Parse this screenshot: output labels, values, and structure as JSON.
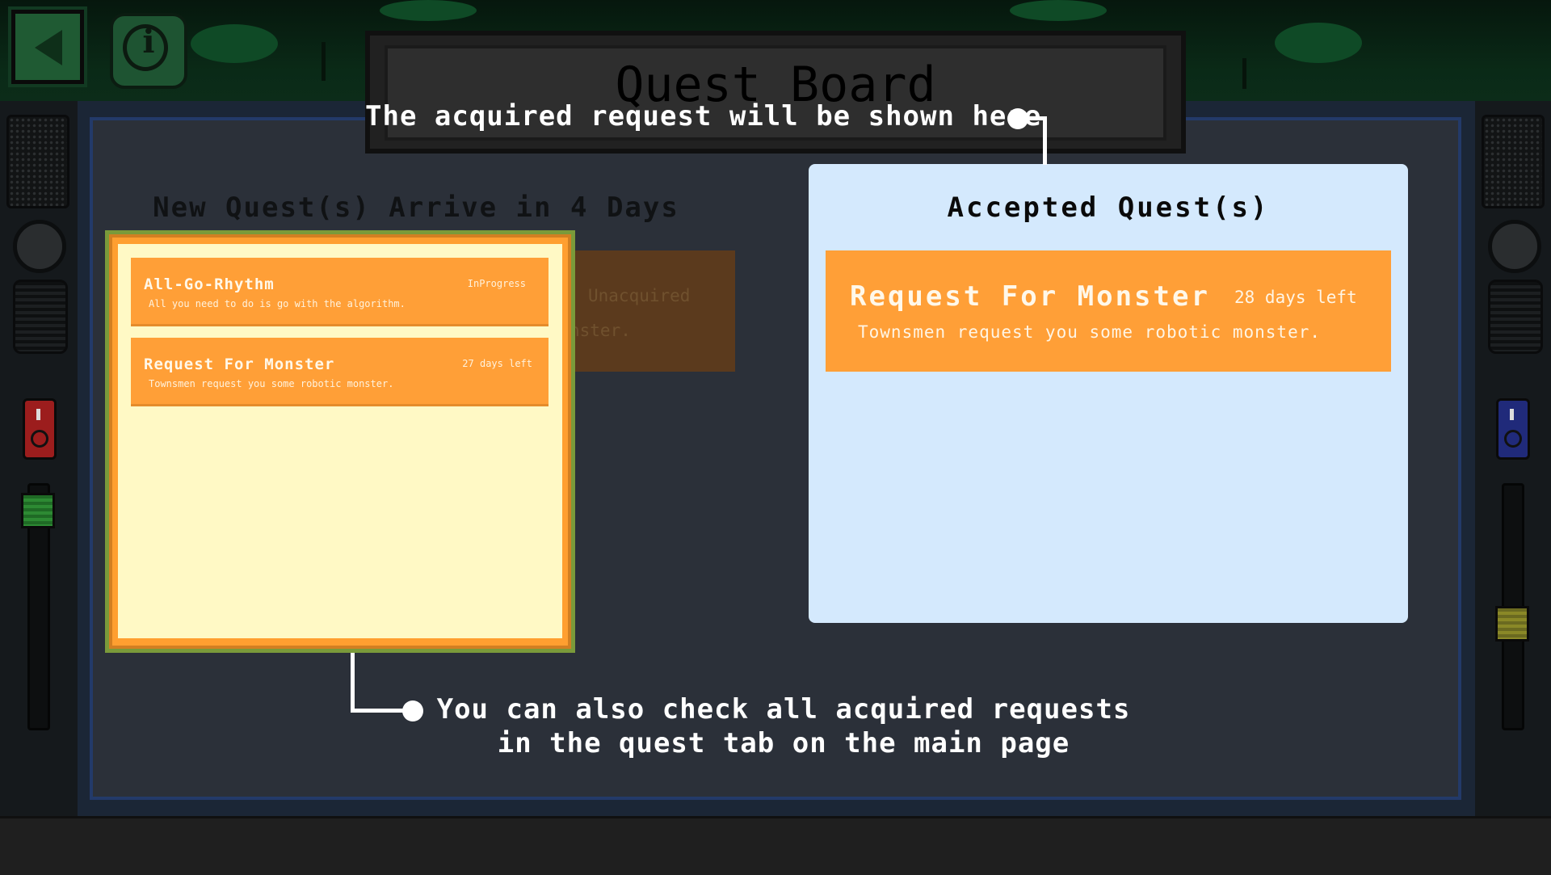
{
  "screen": {
    "title": "Quest Board",
    "arrival_prefix": "New Quest(s) Arrive in",
    "arrival_count": "4",
    "arrival_unit": "Days"
  },
  "hud": {
    "back_icon": "back-arrow-icon",
    "info_icon": "info-icon",
    "info_letter": "i"
  },
  "acquired_panel": {
    "quests": [
      {
        "title": "All-Go-Rhythm",
        "status": "InProgress",
        "description": "All you need to do is go with the algorithm."
      },
      {
        "title": "Request For Monster",
        "status": "27 days left",
        "description": "Townsmen request you some robotic monster."
      }
    ]
  },
  "background_card": {
    "status_fragment": "Unacquired",
    "desc_fragment": "nster."
  },
  "accepted_panel": {
    "header": "Accepted Quest(s)",
    "quests": [
      {
        "title": "Request For Monster",
        "status": "28 days left",
        "description": "Townsmen request you some robotic monster."
      }
    ]
  },
  "tutorial": {
    "top_callout": "The acquired request will be shown here",
    "bottom_callout_line1": "You can also check all acquired requests",
    "bottom_callout_line2": "in the quest tab on the main page"
  },
  "colors": {
    "card_orange": "#ff9f37",
    "accepted_bg": "#d4e9fd",
    "acquired_bg": "#fff9c5",
    "board_bg": "#2b3039"
  }
}
